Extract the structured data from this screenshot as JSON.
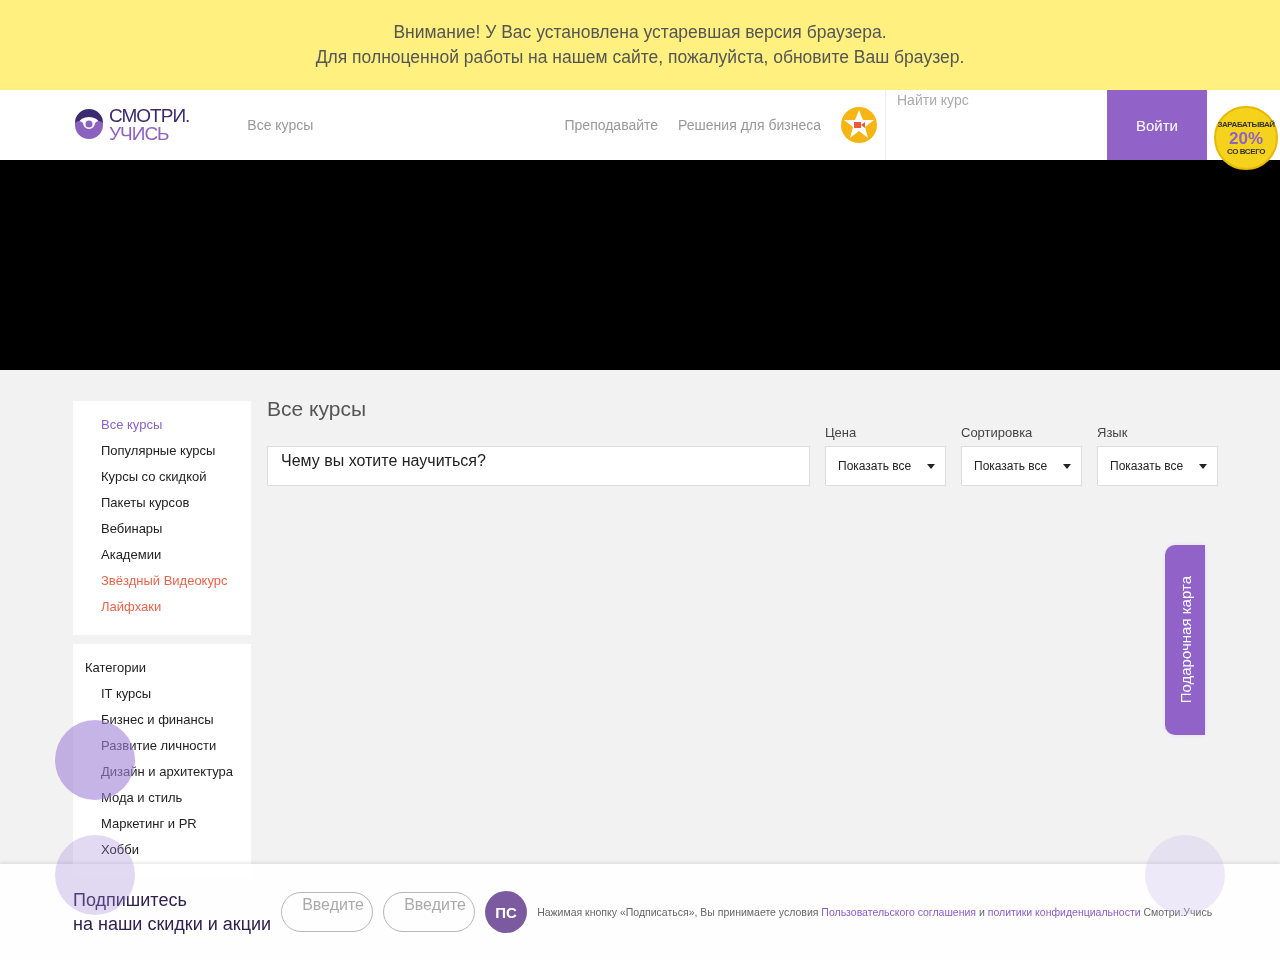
{
  "notice": {
    "lines": [
      "Внимание! У Вас установлена устаревшая версия браузера.",
      "Для полноценной работы на нашем сайте, пожалуйста, обновите Ваш браузер."
    ]
  },
  "header": {
    "logo": {
      "line1": "СМОТРИ.",
      "line2": "УЧИСЬ"
    },
    "nav_left": "Все курсы",
    "nav_right": [
      "Преподавайте",
      "Решения для бизнеса"
    ],
    "search": {
      "placeholder": "Найти курс"
    },
    "login": "Войти",
    "badge": {
      "top": "ЗАРАБАТЫВАЙ",
      "value": "20%",
      "bottom": "СО ВСЕГО"
    }
  },
  "video": {
    "kind": "video"
  },
  "sidebar": {
    "sections": [
      {
        "items": [
          {
            "label": "Все курсы",
            "selected": true,
            "kind": "link"
          },
          {
            "label": "Популярные курсы",
            "selected": false,
            "kind": "link"
          },
          {
            "label": "Курсы со скидкой",
            "selected": false,
            "kind": "link"
          },
          {
            "label": "Пакеты курсов",
            "selected": false,
            "kind": "link"
          },
          {
            "label": "Вебинары",
            "selected": false,
            "kind": "link"
          },
          {
            "label": "Академии",
            "selected": false,
            "kind": "link"
          },
          {
            "label": "Звёздный Видеокурс",
            "selected": false,
            "kind": "promo"
          },
          {
            "label": "Лайфхаки",
            "selected": false,
            "kind": "promo"
          }
        ]
      },
      {
        "title": "Категории",
        "items": [
          {
            "label": "IT курсы",
            "selected": false,
            "kind": "link"
          },
          {
            "label": "Бизнес и финансы",
            "selected": false,
            "kind": "link"
          },
          {
            "label": "Развитие личности",
            "selected": false,
            "kind": "link"
          },
          {
            "label": "Дизайн и архитектура",
            "selected": false,
            "kind": "link"
          },
          {
            "label": "Мода и стиль",
            "selected": false,
            "kind": "link"
          },
          {
            "label": "Маркетинг и PR",
            "selected": false,
            "kind": "link"
          },
          {
            "label": "Хобби",
            "selected": false,
            "kind": "link"
          }
        ]
      }
    ]
  },
  "main": {
    "title": "Все курсы",
    "search": {
      "value": "Чему вы хотите научиться?"
    },
    "filters": [
      {
        "label": "Цена",
        "value": "Показать все"
      },
      {
        "label": "Сортировка",
        "value": "Показать все"
      },
      {
        "label": "Язык",
        "value": "Показать все"
      }
    ]
  },
  "gift_tab": "Подарочная карта",
  "subscribe": {
    "title": "Подпишитесь\nна наши скидки и акции",
    "fields": [
      {
        "placeholder": "Введите"
      },
      {
        "placeholder": "Введите"
      }
    ],
    "button": "ПС",
    "consent": [
      {
        "kind": "text",
        "text": "Нажимая кнопку «Подписаться», Вы принимаете условия"
      },
      {
        "kind": "link",
        "text": "Пользовательского соглашения"
      },
      {
        "kind": "text",
        "text": "и"
      },
      {
        "kind": "link",
        "text": "политики конфиденциальности"
      },
      {
        "kind": "text",
        "text": "Смотри.Учись"
      }
    ]
  }
}
